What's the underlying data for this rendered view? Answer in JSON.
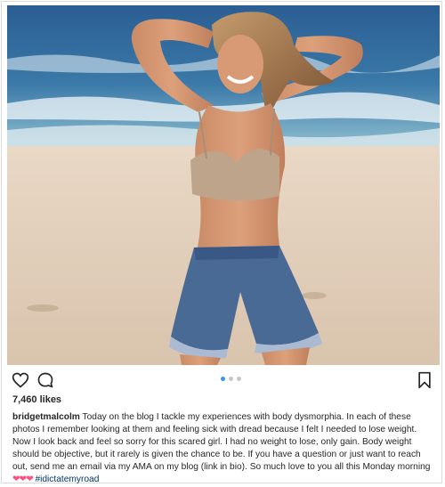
{
  "post": {
    "likes": "7,460 likes",
    "username": "bridgetmalcolm",
    "caption": "Today on the blog I tackle my experiences with body dysmorphia. In each of these photos I remember looking at them and feeling sick with dread because I felt I needed to lose weight. Now I look back and feel so sorry for this scared girl. I had no weight to lose, only gain. Body weight should be objective, but it rarely is given the chance to be. If you have a question or just want to reach out, send me an email via my AMA on my blog (link in bio). So much love to you all this Monday morning",
    "hearts": "❤❤❤",
    "hashtag": "#idictatemyroad",
    "carousel": {
      "count": 3,
      "active_index": 0
    }
  },
  "icons": {
    "like": "heart-outline-icon",
    "comment": "speech-bubble-icon",
    "save": "bookmark-outline-icon"
  },
  "colors": {
    "hashtag": "#003569",
    "active_dot": "#3897f0",
    "hearts": "#ff4f7e"
  }
}
